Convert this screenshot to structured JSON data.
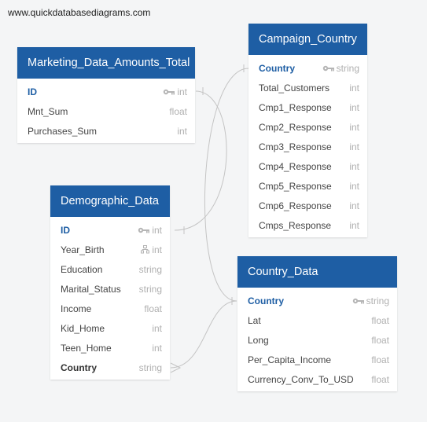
{
  "watermark": "www.quickdatabasediagrams.com",
  "tables": {
    "marketing": {
      "title": "Marketing_Data_Amounts_Total",
      "fields": [
        {
          "name": "ID",
          "type": "int",
          "icon": "key-icon"
        },
        {
          "name": "Mnt_Sum",
          "type": "float"
        },
        {
          "name": "Purchases_Sum",
          "type": "int"
        }
      ]
    },
    "campaign": {
      "title": "Campaign_Country",
      "fields": [
        {
          "name": "Country",
          "type": "string",
          "icon": "key-icon"
        },
        {
          "name": "Total_Customers",
          "type": "int"
        },
        {
          "name": "Cmp1_Response",
          "type": "int"
        },
        {
          "name": "Cmp2_Response",
          "type": "int"
        },
        {
          "name": "Cmp3_Response",
          "type": "int"
        },
        {
          "name": "Cmp4_Response",
          "type": "int"
        },
        {
          "name": "Cmp5_Response",
          "type": "int"
        },
        {
          "name": "Cmp6_Response",
          "type": "int"
        },
        {
          "name": "Cmps_Response",
          "type": "int"
        }
      ]
    },
    "demographic": {
      "title": "Demographic_Data",
      "fields": [
        {
          "name": "ID",
          "type": "int",
          "icon": "key-icon"
        },
        {
          "name": "Year_Birth",
          "type": "int",
          "icon": "hierarchy-icon"
        },
        {
          "name": "Education",
          "type": "string"
        },
        {
          "name": "Marital_Status",
          "type": "string"
        },
        {
          "name": "Income",
          "type": "float"
        },
        {
          "name": "Kid_Home",
          "type": "int"
        },
        {
          "name": "Teen_Home",
          "type": "int"
        },
        {
          "name": "Country",
          "type": "string"
        }
      ]
    },
    "country": {
      "title": "Country_Data",
      "fields": [
        {
          "name": "Country",
          "type": "string",
          "icon": "key-icon"
        },
        {
          "name": "Lat",
          "type": "float"
        },
        {
          "name": "Long",
          "type": "float"
        },
        {
          "name": "Per_Capita_Income",
          "type": "float"
        },
        {
          "name": "Currency_Conv_To_USD",
          "type": "float"
        }
      ]
    }
  },
  "colors": {
    "header_bg": "#1e5ea4",
    "pk_text": "#1e5ea4",
    "type_text": "#b0b0b0",
    "link_line": "#c4c4c4"
  }
}
